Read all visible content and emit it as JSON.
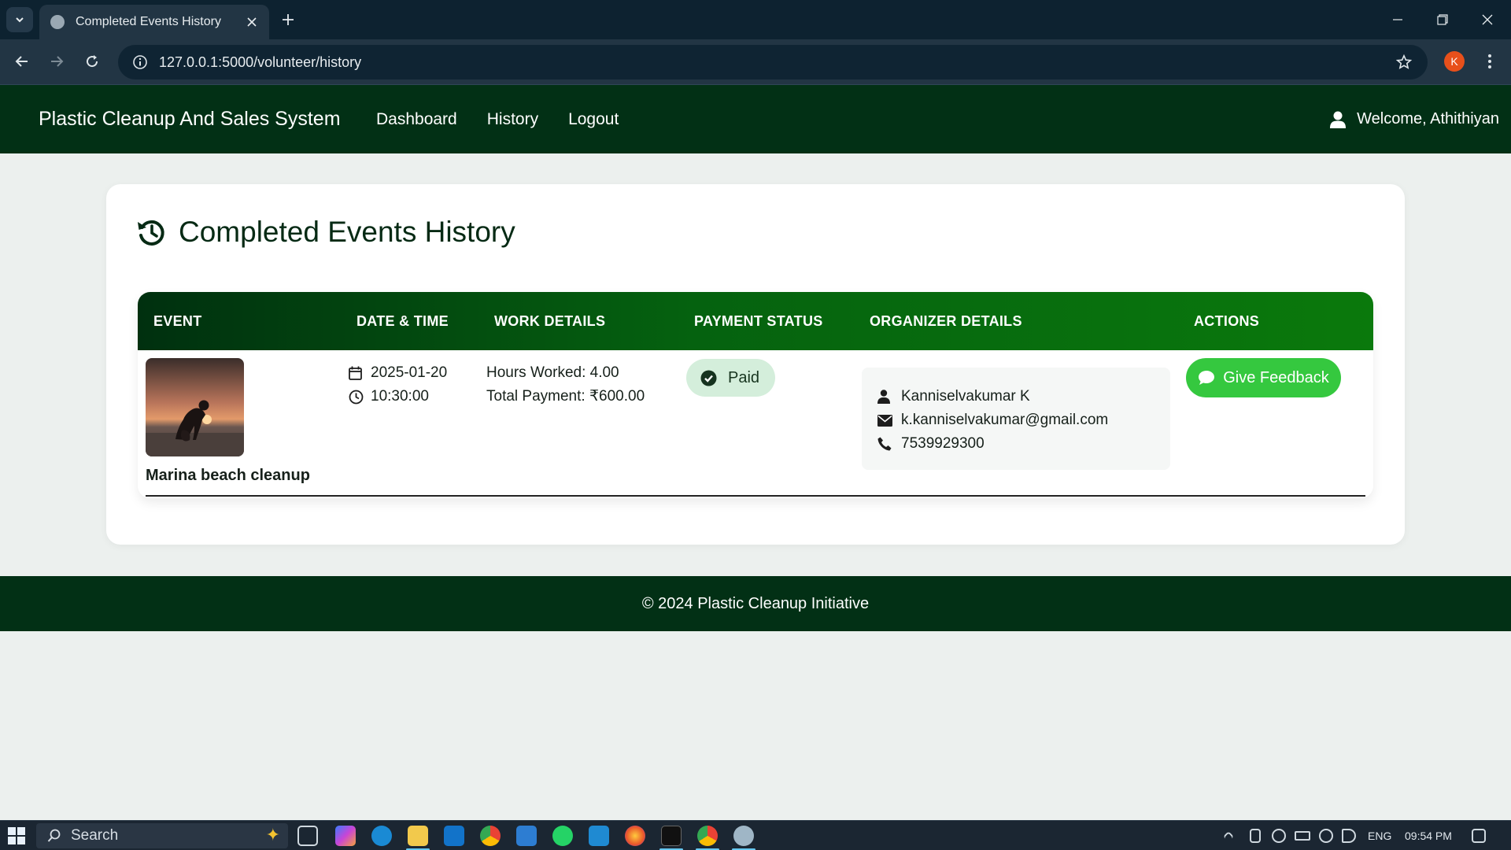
{
  "browser": {
    "tab_title": "Completed Events History",
    "url": "127.0.0.1:5000/volunteer/history",
    "profile_initial": "K"
  },
  "navbar": {
    "brand": "Plastic Cleanup And Sales System",
    "links": [
      "Dashboard",
      "History",
      "Logout"
    ],
    "welcome": "Welcome, Athithiyan"
  },
  "page": {
    "title": "Completed Events History"
  },
  "table": {
    "headers": [
      "EVENT",
      "DATE & TIME",
      "WORK DETAILS",
      "PAYMENT STATUS",
      "ORGANIZER DETAILS",
      "ACTIONS"
    ],
    "rows": [
      {
        "event_name": "Marina beach cleanup",
        "date": "2025-01-20",
        "time": "10:30:00",
        "hours_worked": "Hours Worked: 4.00",
        "total_payment": "Total Payment: ₹600.00",
        "payment_status": "Paid",
        "organizer_name": "Kanniselvakumar K",
        "organizer_email": "k.kanniselvakumar@gmail.com",
        "organizer_phone": "7539929300",
        "action_label": "Give Feedback"
      }
    ]
  },
  "footer": {
    "text": "© 2024 Plastic Cleanup Initiative"
  },
  "taskbar": {
    "search_placeholder": "Search",
    "language": "ENG",
    "time": "09:54 PM"
  },
  "colors": {
    "navbar_bg": "#023015",
    "header_gradient_start": "#00300f",
    "header_gradient_end": "#0a790c",
    "feedback_button": "#35c83f",
    "paid_badge_bg": "#d4eedb",
    "paid_icon": "#1e8a2e"
  }
}
